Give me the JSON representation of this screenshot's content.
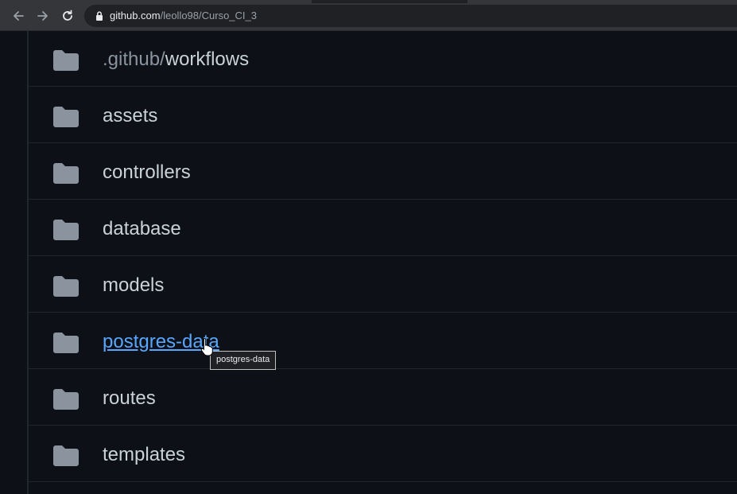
{
  "browser": {
    "url_host": "github.com",
    "url_path": "/leollo98/Curso_CI_3",
    "back_icon": "back-arrow-icon",
    "forward_icon": "forward-arrow-icon",
    "reload_icon": "reload-icon",
    "lock_icon": "lock-icon"
  },
  "files": [
    {
      "prefix": ".github/",
      "name": "workflows",
      "icon": "folder-icon"
    },
    {
      "name": "assets",
      "icon": "folder-icon"
    },
    {
      "name": "controllers",
      "icon": "folder-icon"
    },
    {
      "name": "database",
      "icon": "folder-icon"
    },
    {
      "name": "models",
      "icon": "folder-icon"
    },
    {
      "name": "postgres-data",
      "icon": "folder-icon",
      "hovered": true
    },
    {
      "name": "routes",
      "icon": "folder-icon"
    },
    {
      "name": "templates",
      "icon": "folder-icon"
    }
  ],
  "tooltip": {
    "text": "postgres-data"
  },
  "colors": {
    "background": "#0d1117",
    "text": "#c9d1d9",
    "muted": "#8b949e",
    "link": "#58a6ff",
    "folder": "#8b949e",
    "border": "#21262d"
  }
}
